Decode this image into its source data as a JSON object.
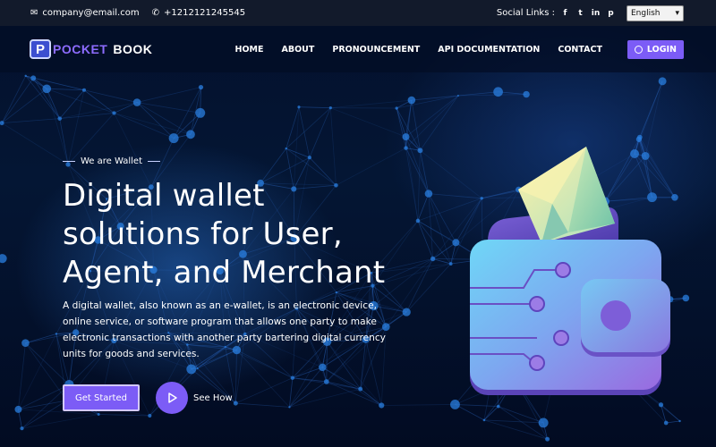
{
  "topbar": {
    "email": "company@email.com",
    "phone": "+1212121245545",
    "social_label": "Social Links :",
    "social_icons": [
      "facebook-icon",
      "twitter-icon",
      "linkedin-icon",
      "pinterest-icon"
    ],
    "language": "English"
  },
  "navbar": {
    "logo_part1": "POCKET",
    "logo_part2": "BOOK",
    "logo_letter": "P",
    "links": [
      "HOME",
      "ABOUT",
      "PRONOUNCEMENT",
      "API DOCUMENTATION",
      "CONTACT"
    ],
    "login_label": "LOGIN"
  },
  "hero": {
    "eyebrow": "We are Wallet",
    "title_line1": "Digital wallet",
    "title_line2": "solutions for User,",
    "title_line3": "Agent, and Merchant",
    "description": "A digital wallet, also known as an e-wallet, is an electronic device, online service, or software program that allows one party to make electronic transactions with another party bartering digital currency units for goods and services.",
    "cta_label": "Get Started",
    "see_how_label": "See How"
  },
  "colors": {
    "accent": "#7c5cf6",
    "topbar_bg": "#121a2b",
    "page_bg": "#031230"
  }
}
